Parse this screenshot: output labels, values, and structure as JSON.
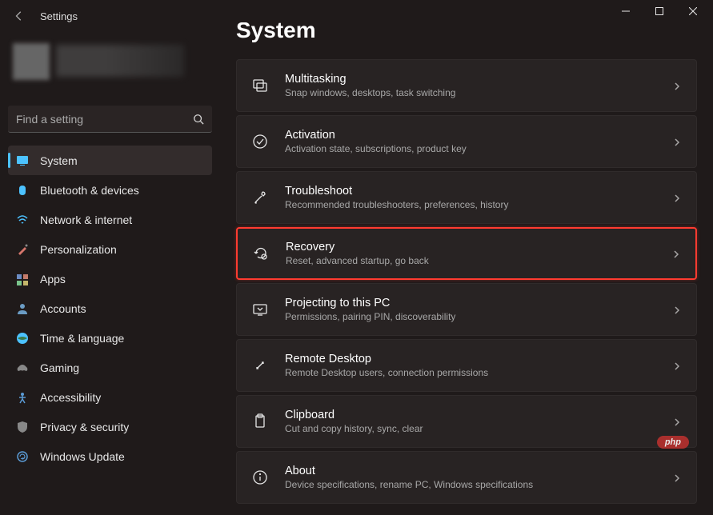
{
  "app_title": "Settings",
  "page_title": "System",
  "search": {
    "placeholder": "Find a setting"
  },
  "nav": [
    {
      "label": "System",
      "active": true
    },
    {
      "label": "Bluetooth & devices"
    },
    {
      "label": "Network & internet"
    },
    {
      "label": "Personalization"
    },
    {
      "label": "Apps"
    },
    {
      "label": "Accounts"
    },
    {
      "label": "Time & language"
    },
    {
      "label": "Gaming"
    },
    {
      "label": "Accessibility"
    },
    {
      "label": "Privacy & security"
    },
    {
      "label": "Windows Update"
    }
  ],
  "cards": [
    {
      "title": "Multitasking",
      "subtitle": "Snap windows, desktops, task switching"
    },
    {
      "title": "Activation",
      "subtitle": "Activation state, subscriptions, product key"
    },
    {
      "title": "Troubleshoot",
      "subtitle": "Recommended troubleshooters, preferences, history"
    },
    {
      "title": "Recovery",
      "subtitle": "Reset, advanced startup, go back",
      "highlight": true
    },
    {
      "title": "Projecting to this PC",
      "subtitle": "Permissions, pairing PIN, discoverability"
    },
    {
      "title": "Remote Desktop",
      "subtitle": "Remote Desktop users, connection permissions"
    },
    {
      "title": "Clipboard",
      "subtitle": "Cut and copy history, sync, clear"
    },
    {
      "title": "About",
      "subtitle": "Device specifications, rename PC, Windows specifications"
    }
  ],
  "badge": "php"
}
